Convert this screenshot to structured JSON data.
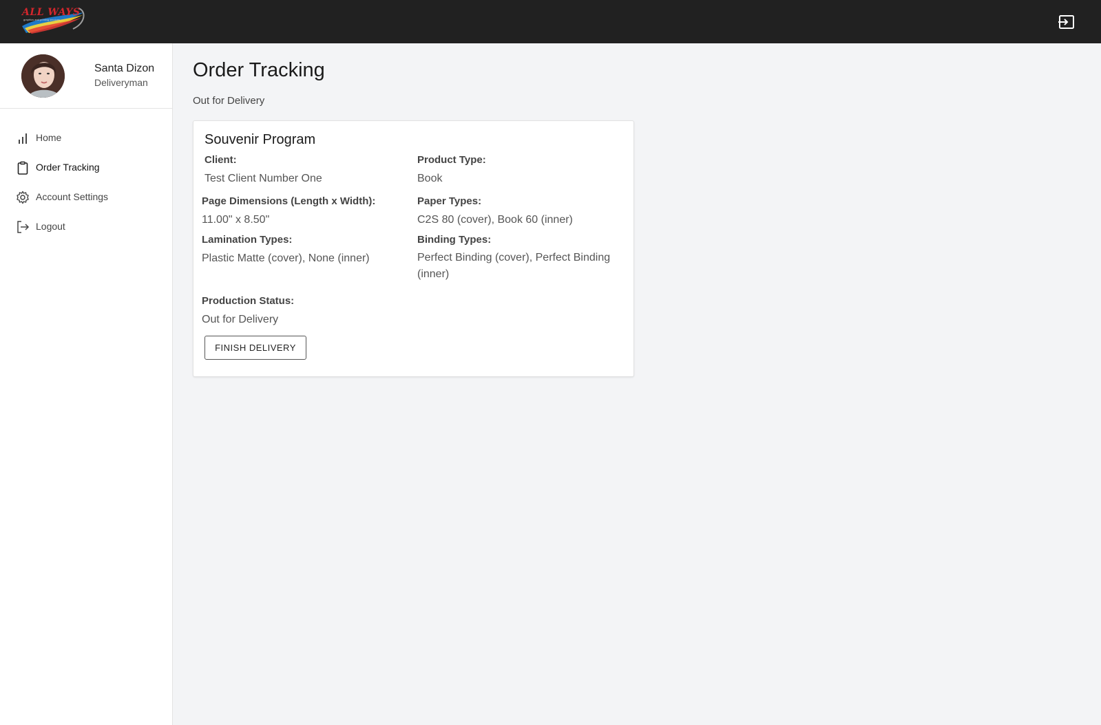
{
  "header": {
    "logo_text": "ALL WAYS",
    "logo_tagline": "graphics and printing services",
    "exit_icon": "exit-to-app-icon"
  },
  "sidebar": {
    "profile": {
      "name": "Santa Dizon",
      "role": "Deliveryman"
    },
    "items": [
      {
        "label": "Home",
        "icon": "bar-chart-icon",
        "active": false
      },
      {
        "label": "Order Tracking",
        "icon": "clipboard-icon",
        "active": true
      },
      {
        "label": "Account Settings",
        "icon": "gear-icon",
        "active": false
      },
      {
        "label": "Logout",
        "icon": "logout-icon",
        "active": false
      }
    ]
  },
  "main": {
    "title": "Order Tracking",
    "subtitle": "Out for Delivery",
    "order": {
      "name": "Souvenir Program",
      "client_label": "Client:",
      "client": "Test Client Number One",
      "product_type_label": "Product Type:",
      "product_type": "Book",
      "page_dimensions_label": "Page Dimensions (Length x Width):",
      "page_dimensions": "11.00\" x 8.50\"",
      "paper_types_label": "Paper Types:",
      "paper_types": "C2S 80 (cover), Book 60 (inner)",
      "lamination_types_label": "Lamination Types:",
      "lamination_types": "Plastic Matte (cover), None (inner)",
      "binding_types_label": "Binding Types:",
      "binding_types": "Perfect Binding (cover), Perfect Binding (inner)",
      "production_status_label": "Production Status:",
      "production_status": "Out for Delivery",
      "finish_button": "FINISH DELIVERY"
    }
  },
  "colors": {
    "topbar": "#212121",
    "background": "#f3f4f6",
    "card": "#ffffff"
  }
}
